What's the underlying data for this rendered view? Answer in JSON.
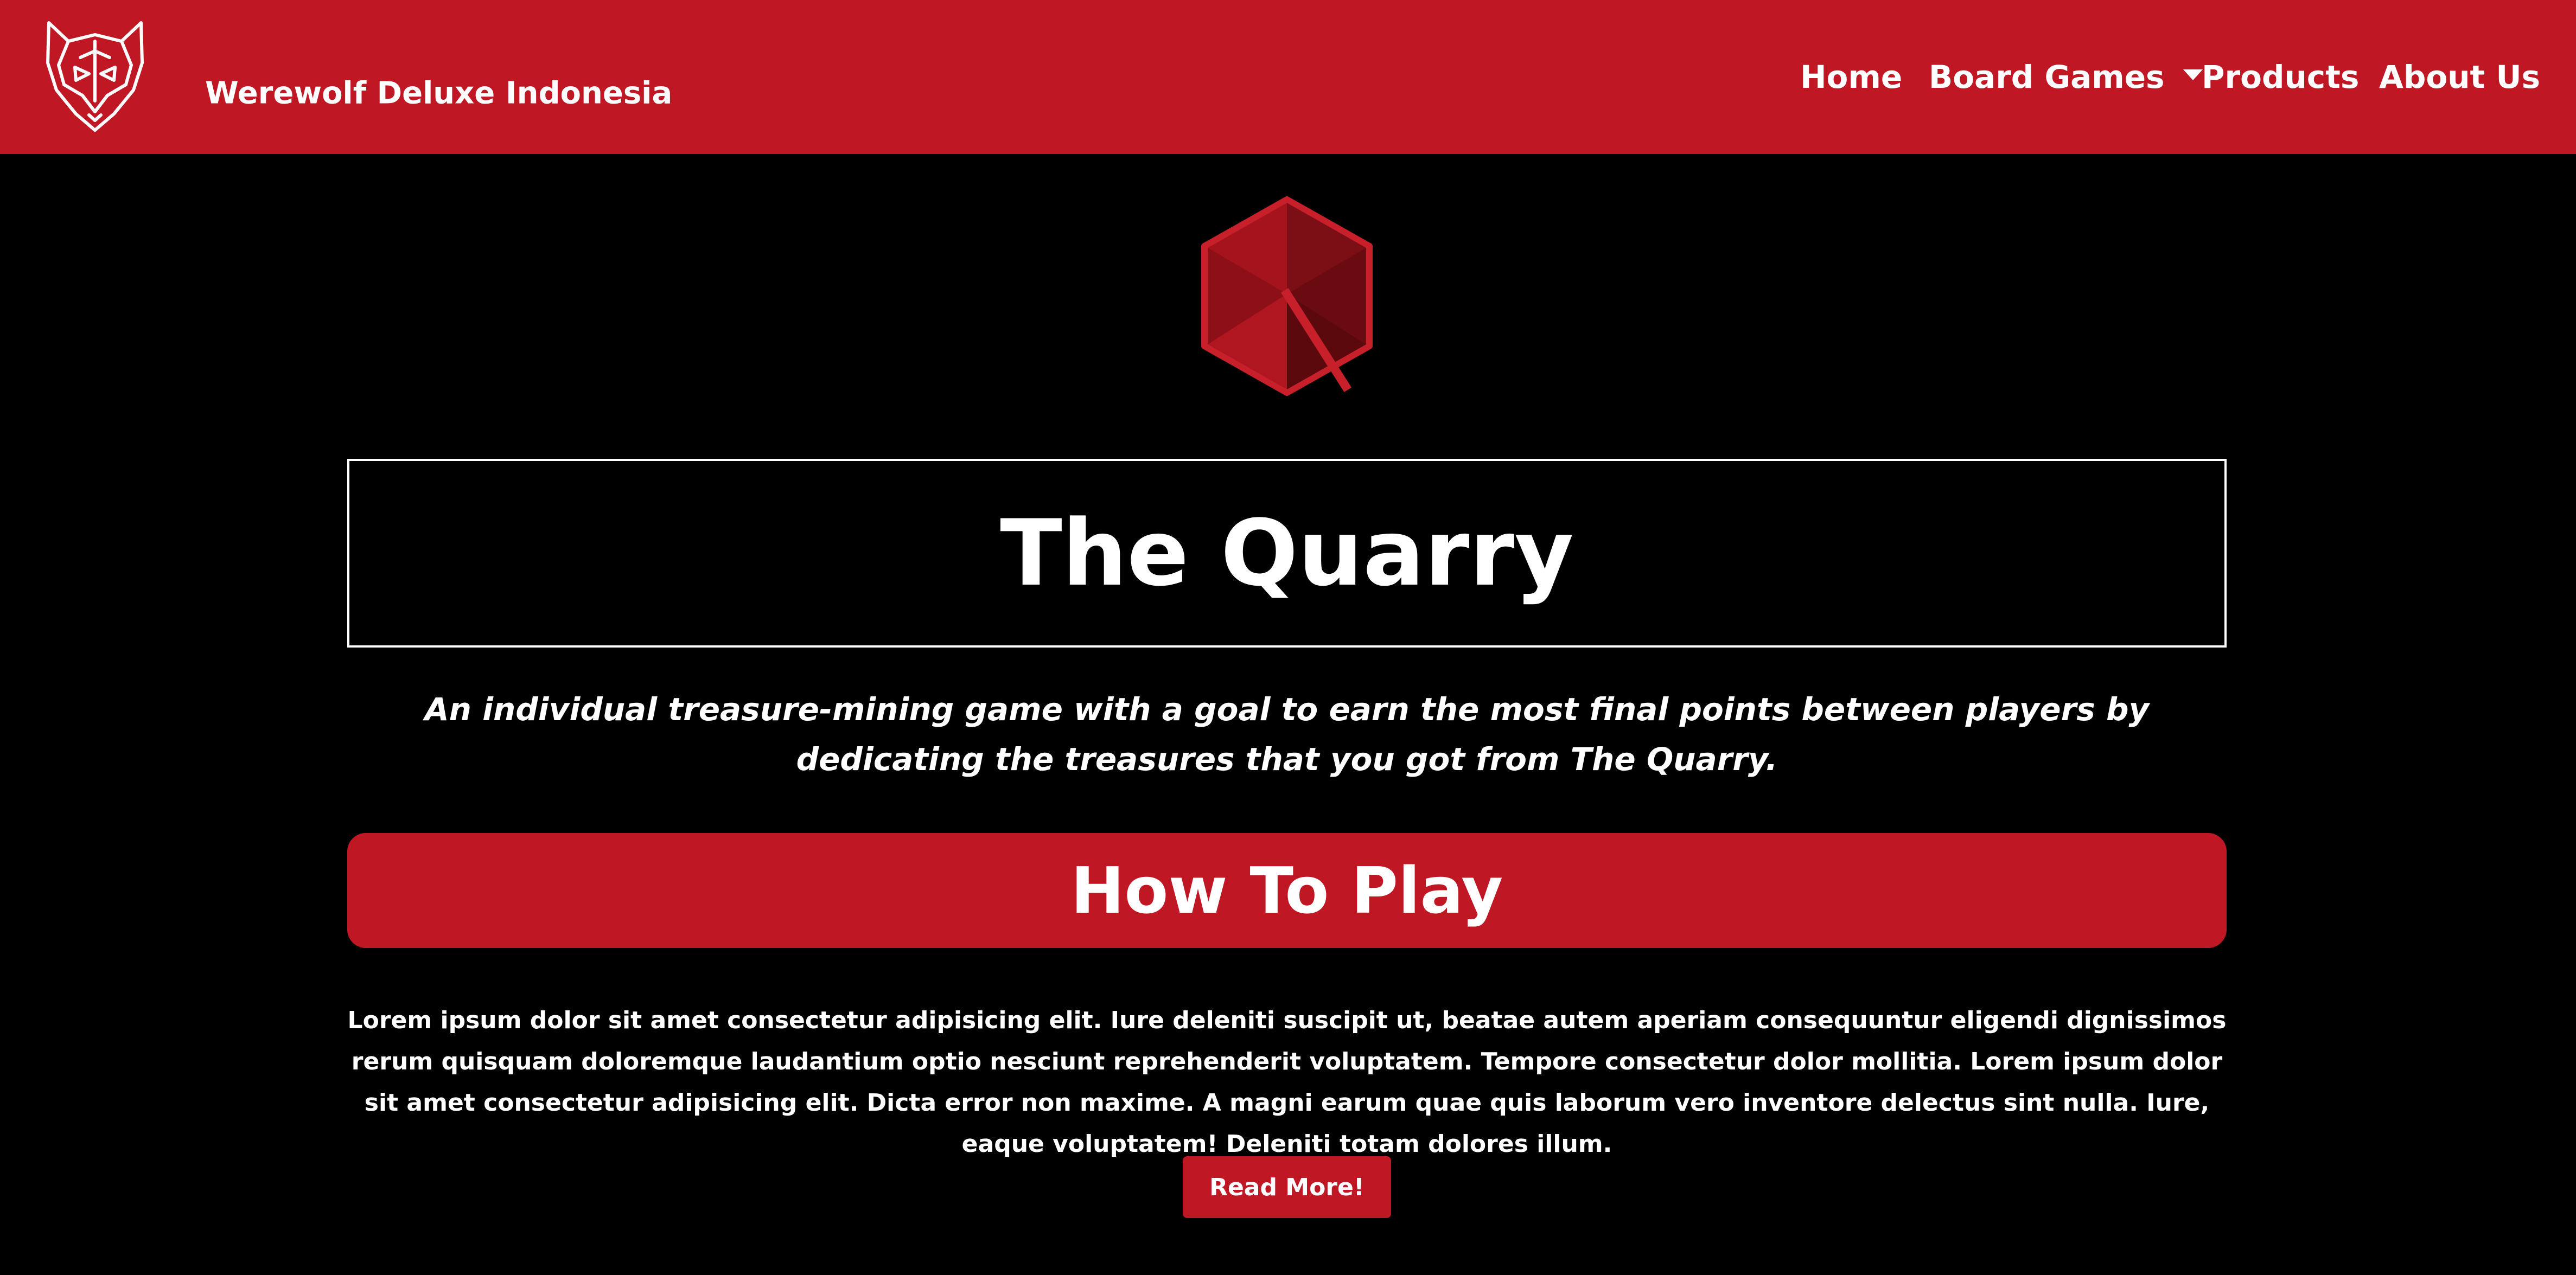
{
  "navbar": {
    "brand_name": "Werewolf Deluxe Indonesia",
    "logo_icon": "wolf-head-icon",
    "links": [
      {
        "label": "Home"
      },
      {
        "label": "Board Games",
        "has_dropdown": true
      },
      {
        "label": "Products"
      },
      {
        "label": "About Us"
      }
    ]
  },
  "hero": {
    "icon": "red-gem-hexagon-icon",
    "title": "The Quarry",
    "tagline": "An individual treasure-mining game with a goal to earn the most final points between players by dedicating the treasures that you got from The Quarry."
  },
  "how_to_play": {
    "heading": "How To Play",
    "body": "Lorem ipsum dolor sit amet consectetur adipisicing elit. Iure deleniti suscipit ut, beatae autem aperiam consequuntur eligendi dignissimos rerum quisquam doloremque laudantium optio nesciunt reprehenderit voluptatem. Tempore consectetur dolor mollitia. Lorem ipsum dolor sit amet consectetur adipisicing elit. Dicta error non maxime. A magni earum quae quis laborum vero inventore delectus sint nulla. Iure, eaque voluptatem! Deleniti totam dolores illum.",
    "button_label": "Read More!"
  },
  "colors": {
    "brand_red": "#bf1724",
    "background": "#000000",
    "text": "#ffffff"
  }
}
